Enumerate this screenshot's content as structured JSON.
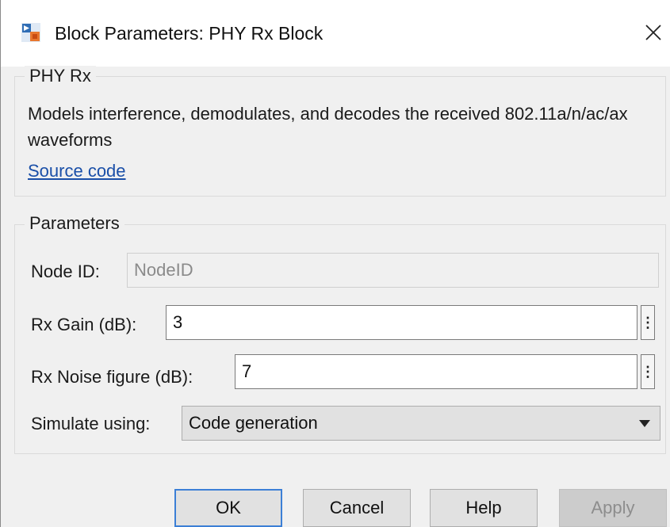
{
  "window": {
    "title": "Block Parameters: PHY Rx Block",
    "app_icon": "simulink-block-icon",
    "close_icon": "close-icon"
  },
  "block_group": {
    "legend": "PHY Rx",
    "description": "Models interference, demodulates, and decodes the received 802.11a/n/ac/ax waveforms",
    "link_label": "Source code"
  },
  "parameters": {
    "legend": "Parameters",
    "node_id": {
      "label": "Node ID:",
      "value": "NodeID"
    },
    "rx_gain": {
      "label": "Rx Gain (dB):",
      "value": "3"
    },
    "rx_noise_figure": {
      "label": "Rx Noise figure (dB):",
      "value": "7"
    },
    "simulate_using": {
      "label": "Simulate using:",
      "value": "Code generation"
    },
    "more_glyph": "⋮"
  },
  "buttons": {
    "ok": "OK",
    "cancel": "Cancel",
    "help": "Help",
    "apply": "Apply"
  },
  "colors": {
    "default_button_border": "#3c7fd6",
    "link": "#1a4fa8"
  }
}
